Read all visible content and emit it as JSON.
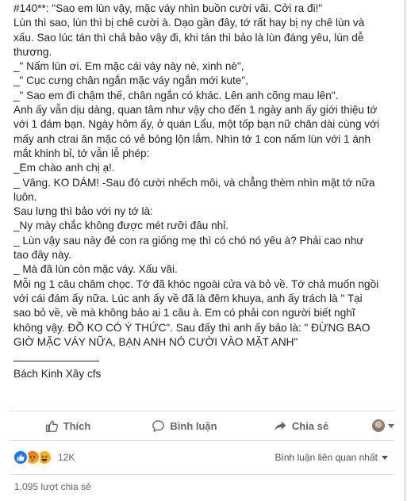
{
  "post": {
    "lines": [
      "#140**: \"Sao em lùn vậy, mặc váy nhìn buồn cười vãi. Cởi ra đi!\"",
      "Lùn thì sao, lùn thì bị chê cười à. Dạo gần đây, tớ rất hay bị ny chê lùn và",
      "xấu. Sao lúc tán thì chả bảo vậy đi, khi tán thì bảo là lùn đáng yêu, lùn dễ",
      "thương.",
      "_\" Nấm lùn ơi. Em mặc cái váy này nè, xinh nè\",",
      "_\" Cục cưng chân ngắn mặc váy ngắn mới kute\",",
      "_\" Sao em đi chậm thế, chân ngắn có khác. Lên anh cõng mau lên\".",
      "Anh ấy vẫn dịu dàng, quan tâm như vậy cho đến 1 ngày anh ấy giới thiệu tớ",
      "với 1 đám bạn. Ngày hôm ấy, ở quán Lẩu, một tốp bạn nữ chân dài cùng với",
      "mấy anh ctrai ăn mặc có vẻ bóng lộn lắm. Nhìn tớ 1 con nấm lùn với 1 ánh",
      "mắt khinh bỉ, tớ vẫn lễ phép:",
      "_Em chào anh chị ạ!.",
      "_ Vâng. KO DÁM! -Sau đó cười nhếch môi, và chẳng thèm nhìn mặt tớ nữa",
      "luôn.",
      "Sau lưng thì bảo với ny tớ là:",
      "_Ny mày chắc không được mét rưỡi đâu nhỉ.",
      "_ Lùn vậy sau này đẻ con ra giống mẹ thì có chó nó yêu à? Phải cao như",
      "tao đây này.",
      "_ Mà đã lùn còn mặc váy. Xấu vãi.",
      "Mỗi ng 1 câu châm chọc. Tớ đã khóc ngoài cửa và bỏ về. Tớ chả muốn ngồi",
      "với cái đám ấy nữa. Lúc anh ấy về đã là đêm khuya, anh ấy trách là \" Tại",
      "sao bỏ về, về mà không bảo ai 1 câu à. Em có phải con người biết nghĩ",
      "không vậy. ĐỒ KO CÓ Ý THỨC\". Sau đấy thì anh ấy bảo là: \" ĐỪNG BAO",
      "GIỜ MẶC VÁY NỮA, BẠN ANH NÓ CƯỜI VÀO MẶT ANH\""
    ],
    "signature": "Bách Kinh Xây cfs"
  },
  "actions": {
    "like": "Thích",
    "comment": "Bình luận",
    "share": "Chia sẻ"
  },
  "reactions": {
    "icons": [
      "like-icon",
      "angry-icon",
      "haha-icon"
    ],
    "count": "12K",
    "sort_label": "Bình luận liên quan nhất"
  },
  "shares": {
    "text": "1.095 lượt chia sẻ"
  },
  "colors": {
    "text": "#1d2129",
    "secondary": "#606770",
    "like_blue": "#1877f2",
    "haha_yellow": "#f7b125"
  }
}
